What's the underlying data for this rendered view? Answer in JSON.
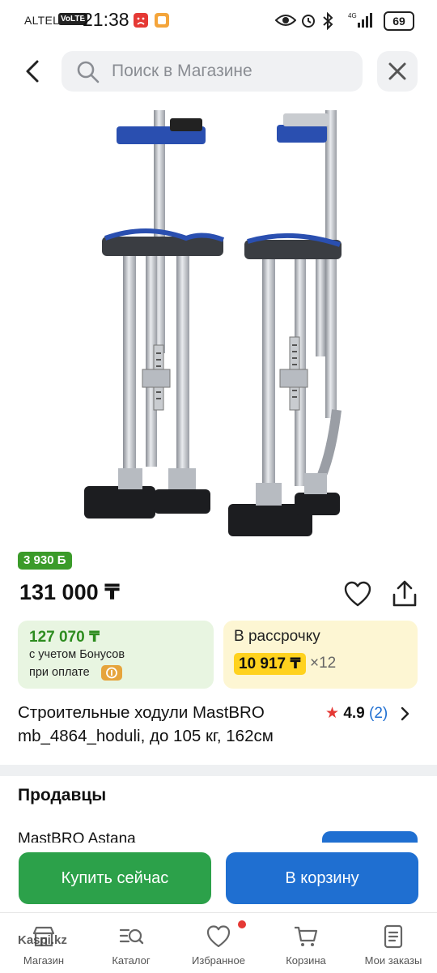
{
  "status_bar": {
    "carrier": "ALTEL",
    "volte": "VoLTE",
    "time": "21:38",
    "battery": "69"
  },
  "header": {
    "search_placeholder": "Поиск в Магазине"
  },
  "product": {
    "bonus_badge": "3 930 Б",
    "price": "131 000 ₸",
    "title_line1": "Строительные ходули MastBRO",
    "title_line2": "mb_4864_hoduli, до 105 кг, 162см",
    "rating": "4.9",
    "reviews": "(2)"
  },
  "bonus_card": {
    "amount": "127 070 ₸",
    "line1": "с учетом Бонусов",
    "line2": "при оплате"
  },
  "installment_card": {
    "title": "В рассрочку",
    "amount": "10 917 ₸",
    "multiplier": "×12"
  },
  "sellers": {
    "title": "Продавцы",
    "first_seller": "MastBRO Astana"
  },
  "actions": {
    "buy_now": "Купить сейчас",
    "add_to_cart": "В корзину"
  },
  "nav": {
    "items": [
      {
        "label": "Магазин",
        "icon": "store-icon"
      },
      {
        "label": "Каталог",
        "icon": "catalog-search-icon"
      },
      {
        "label": "Избранное",
        "icon": "heart-icon"
      },
      {
        "label": "Корзина",
        "icon": "cart-icon"
      },
      {
        "label": "Мои заказы",
        "icon": "orders-icon"
      }
    ]
  },
  "watermark": "Kaspi.kz",
  "colors": {
    "green": "#2ca14a",
    "blue": "#1f6fd1",
    "yellow": "#ffd21e",
    "red": "#e53935"
  }
}
